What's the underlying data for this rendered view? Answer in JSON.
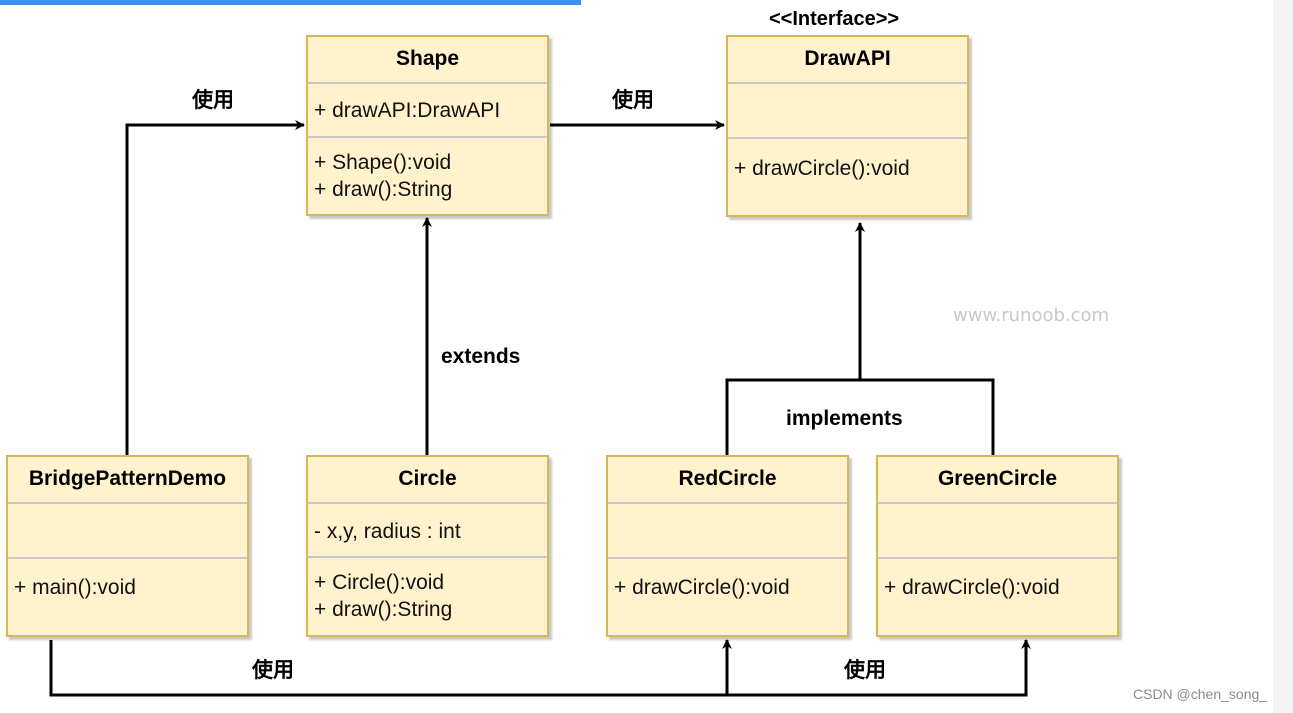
{
  "classes": {
    "shape": {
      "name": "Shape",
      "attributes": [
        "+ drawAPI:DrawAPI"
      ],
      "methods": [
        "+ Shape():void",
        "+ draw():String"
      ]
    },
    "drawapi": {
      "stereotype": "<<Interface>>",
      "name": "DrawAPI",
      "attributes": [],
      "methods": [
        "+ drawCircle():void"
      ]
    },
    "bridge": {
      "name": "BridgePatternDemo",
      "attributes": [],
      "methods": [
        "+ main():void"
      ]
    },
    "circle": {
      "name": "Circle",
      "attributes": [
        "- x,y, radius : int"
      ],
      "methods": [
        "+ Circle():void",
        "+ draw():String"
      ]
    },
    "redcircle": {
      "name": "RedCircle",
      "attributes": [],
      "methods": [
        "+ drawCircle():void"
      ]
    },
    "greencircle": {
      "name": "GreenCircle",
      "attributes": [],
      "methods": [
        "+ drawCircle():void"
      ]
    }
  },
  "labels": {
    "use_bridge_shape": "使用",
    "use_shape_drawapi": "使用",
    "extends": "extends",
    "implements": "implements",
    "use_bridge_circles_left": "使用",
    "use_bridge_circles_right": "使用"
  },
  "watermark": "www.runoob.com",
  "credit": "CSDN @chen_song_",
  "colors": {
    "class_fill": "#fff2cc",
    "class_border": "#d6b656",
    "accent_bar": "#3d8ef2"
  }
}
